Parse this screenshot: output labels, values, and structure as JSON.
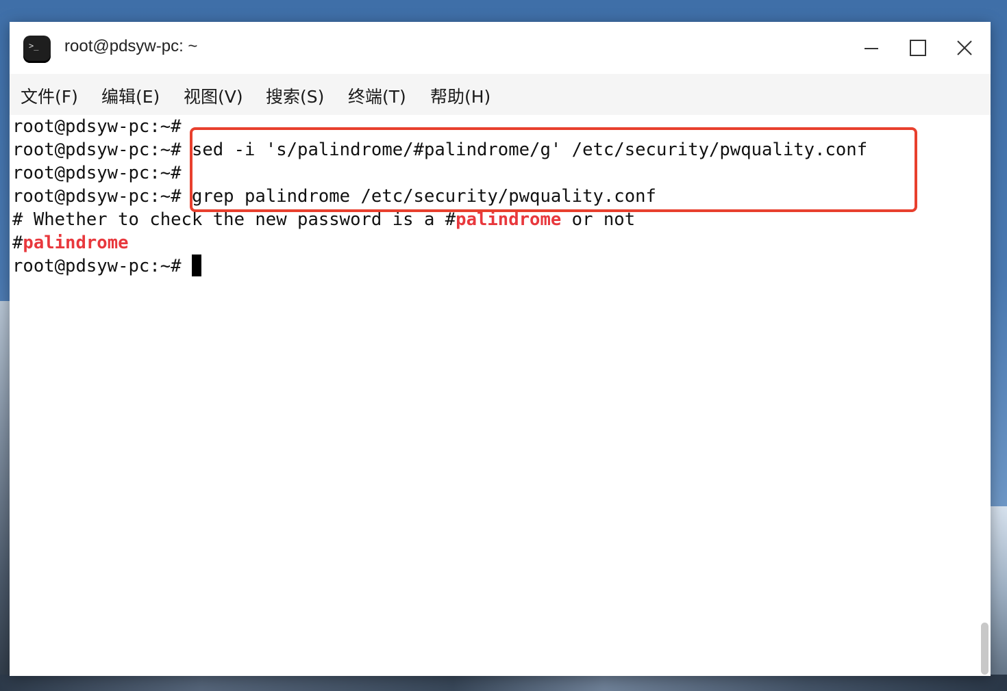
{
  "window": {
    "title": "root@pdsyw-pc: ~",
    "icon": "terminal-icon",
    "controls": [
      "minimize-icon",
      "maximize-icon",
      "close-icon"
    ]
  },
  "menu": [
    {
      "label": "文件(F)"
    },
    {
      "label": "编辑(E)"
    },
    {
      "label": "视图(V)"
    },
    {
      "label": "搜索(S)"
    },
    {
      "label": "终端(T)"
    },
    {
      "label": "帮助(H)"
    }
  ],
  "terminal": {
    "prompt": "root@pdsyw-pc:~#",
    "lines": [
      {
        "prompt": "root@pdsyw-pc:~#",
        "command": ""
      },
      {
        "prompt": "root@pdsyw-pc:~#",
        "command": " sed -i 's/palindrome/#palindrome/g' /etc/security/pwquality.conf"
      },
      {
        "prompt": "root@pdsyw-pc:~#",
        "command": ""
      },
      {
        "prompt": "root@pdsyw-pc:~#",
        "command": " grep palindrome /etc/security/pwquality.conf"
      }
    ],
    "output": [
      {
        "before": "# Whether to check the new password is a #",
        "match": "palindrome",
        "after": " or not"
      },
      {
        "before": "#",
        "match": "palindrome",
        "after": ""
      }
    ],
    "last_prompt": "root@pdsyw-pc:~# "
  },
  "colors": {
    "match": "#e8383d",
    "highlight_box": "#e8402e",
    "text": "#111111",
    "background": "#ffffff"
  }
}
